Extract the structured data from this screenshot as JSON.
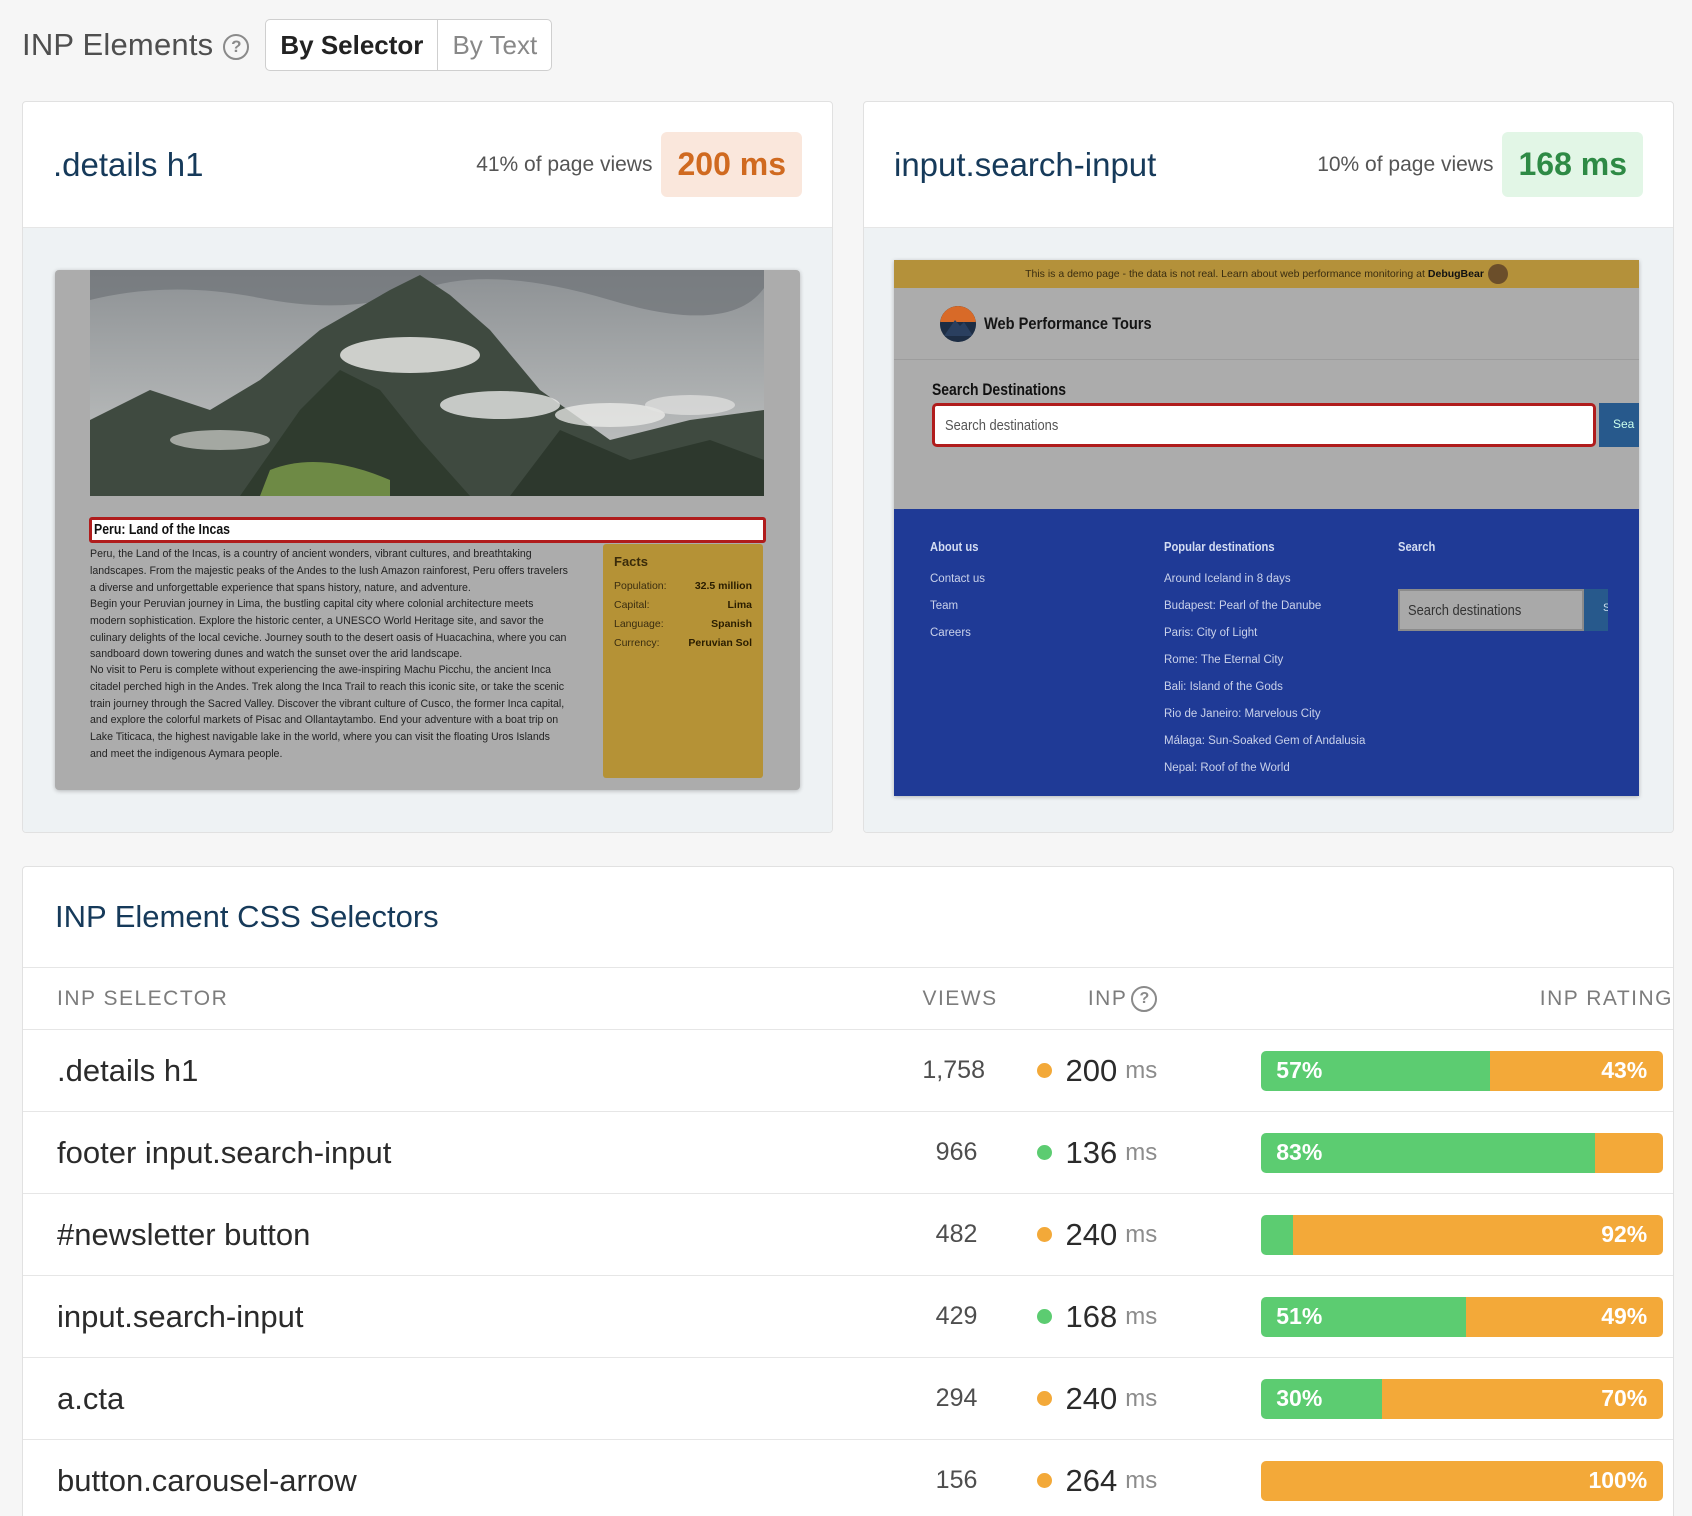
{
  "header": {
    "title": "INP Elements",
    "toggle": [
      "By Selector",
      "By Text"
    ]
  },
  "colors": {
    "good": "#5ccc71",
    "needs_improvement": "#f3a939",
    "title_blue": "#163a5a"
  },
  "cards": [
    {
      "selector": ".details h1",
      "views": "41% of page views",
      "inp": "200 ms",
      "rating": "poor",
      "screenshot": {
        "heading": "Peru: Land of the Incas",
        "paragraphs": [
          "Peru, the Land of the Incas, is a country of ancient wonders, vibrant cultures, and breathtaking landscapes. From the majestic peaks of the Andes to the lush Amazon rainforest, Peru offers travelers a diverse and unforgettable experience that spans history, nature, and adventure.",
          "Begin your Peruvian journey in Lima, the bustling capital city where colonial architecture meets modern sophistication. Explore the historic center, a UNESCO World Heritage site, and savor the culinary delights of the local ceviche. Journey south to the desert oasis of Huacachina, where you can sandboard down towering dunes and watch the sunset over the arid landscape.",
          "No visit to Peru is complete without experiencing the awe-inspiring Machu Picchu, the ancient Inca citadel perched high in the Andes. Trek along the Inca Trail to reach this iconic site, or take the scenic train journey through the Sacred Valley. Discover the vibrant culture of Cusco, the former Inca capital, and explore the colorful markets of Pisac and Ollantaytambo. End your adventure with a boat trip on Lake Titicaca, the highest navigable lake in the world, where you can visit the floating Uros Islands and meet the indigenous Aymara people."
        ],
        "facts_title": "Facts",
        "facts": [
          {
            "label": "Population:",
            "value": "32.5 million"
          },
          {
            "label": "Capital:",
            "value": "Lima"
          },
          {
            "label": "Language:",
            "value": "Spanish"
          },
          {
            "label": "Currency:",
            "value": "Peruvian Sol"
          }
        ]
      }
    },
    {
      "selector": "input.search-input",
      "views": "10% of page views",
      "inp": "168 ms",
      "rating": "good",
      "screenshot": {
        "banner_text": "This is a demo page - the data is not real. Learn about web performance monitoring at",
        "banner_brand": "DebugBear",
        "site_name": "Web Performance Tours",
        "search_label": "Search Destinations",
        "search_placeholder": "Search destinations",
        "search_button": "Sea",
        "footer": {
          "about_title": "About us",
          "about_links": [
            "Contact us",
            "Team",
            "Careers"
          ],
          "popular_title": "Popular destinations",
          "popular_links": [
            "Around Iceland in 8 days",
            "Budapest: Pearl of the Danube",
            "Paris: City of Light",
            "Rome: The Eternal City",
            "Bali: Island of the Gods",
            "Rio de Janeiro: Marvelous City",
            "Málaga: Sun-Soaked Gem of Andalusia",
            "Nepal: Roof of the World"
          ],
          "search_title": "Search",
          "search_placeholder": "Search destinations",
          "search_button": "S"
        }
      }
    }
  ],
  "table": {
    "title": "INP Element CSS Selectors",
    "headers": {
      "selector": "INP SELECTOR",
      "views": "VIEWS",
      "inp": "INP",
      "rating": "INP RATING"
    },
    "unit": "ms",
    "rows": [
      {
        "selector": ".details h1",
        "views": "1,758",
        "inp": "200",
        "status": "poor",
        "good_pct": 57,
        "poor_pct": 43,
        "good_label": "57%",
        "poor_label": "43%"
      },
      {
        "selector": "footer input.search-input",
        "views": "966",
        "inp": "136",
        "status": "good",
        "good_pct": 83,
        "poor_pct": 17,
        "good_label": "83%",
        "poor_label": ""
      },
      {
        "selector": "#newsletter button",
        "views": "482",
        "inp": "240",
        "status": "poor",
        "good_pct": 8,
        "poor_pct": 92,
        "good_label": "",
        "poor_label": "92%"
      },
      {
        "selector": "input.search-input",
        "views": "429",
        "inp": "168",
        "status": "good",
        "good_pct": 51,
        "poor_pct": 49,
        "good_label": "51%",
        "poor_label": "49%"
      },
      {
        "selector": "a.cta",
        "views": "294",
        "inp": "240",
        "status": "poor",
        "good_pct": 30,
        "poor_pct": 70,
        "good_label": "30%",
        "poor_label": "70%"
      },
      {
        "selector": "button.carousel-arrow",
        "views": "156",
        "inp": "264",
        "status": "poor",
        "good_pct": 0,
        "poor_pct": 100,
        "good_label": "",
        "poor_label": "100%"
      }
    ]
  }
}
